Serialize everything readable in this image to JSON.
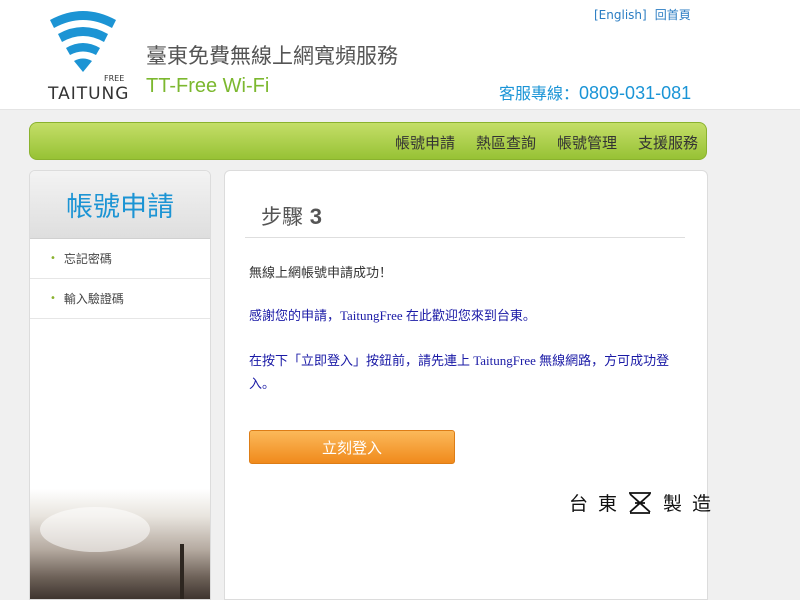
{
  "header": {
    "logo_word": "TAITUNG",
    "logo_free": "FREE",
    "title": "臺東免費無線上網寬頻服務",
    "subtitle": "TT-Free Wi-Fi",
    "links": {
      "english": "[English]",
      "home": "回首頁"
    },
    "hotline_label": "客服專線：",
    "hotline_number": "0809-031-081"
  },
  "nav": {
    "items": [
      "帳號申請",
      "熱區查詢",
      "帳號管理",
      "支援服務"
    ]
  },
  "sidebar": {
    "title": "帳號申請",
    "items": [
      "忘記密碼",
      "輸入驗證碼"
    ]
  },
  "main": {
    "step_label": "步驟",
    "step_number": "3",
    "success": "無線上網帳號申請成功！",
    "thanks": "感謝您的申請，TaitungFree 在此歡迎您來到台東。",
    "note": "在按下「立即登入」按鈕前，請先連上 TaitungFree 無線網路，方可成功登入。",
    "login_button": "立刻登入",
    "maker": [
      "台",
      "東",
      "製",
      "造"
    ]
  },
  "colors": {
    "accent_blue": "#1c94d4",
    "nav_green": "#97c235",
    "button_orange": "#f08a1c"
  }
}
